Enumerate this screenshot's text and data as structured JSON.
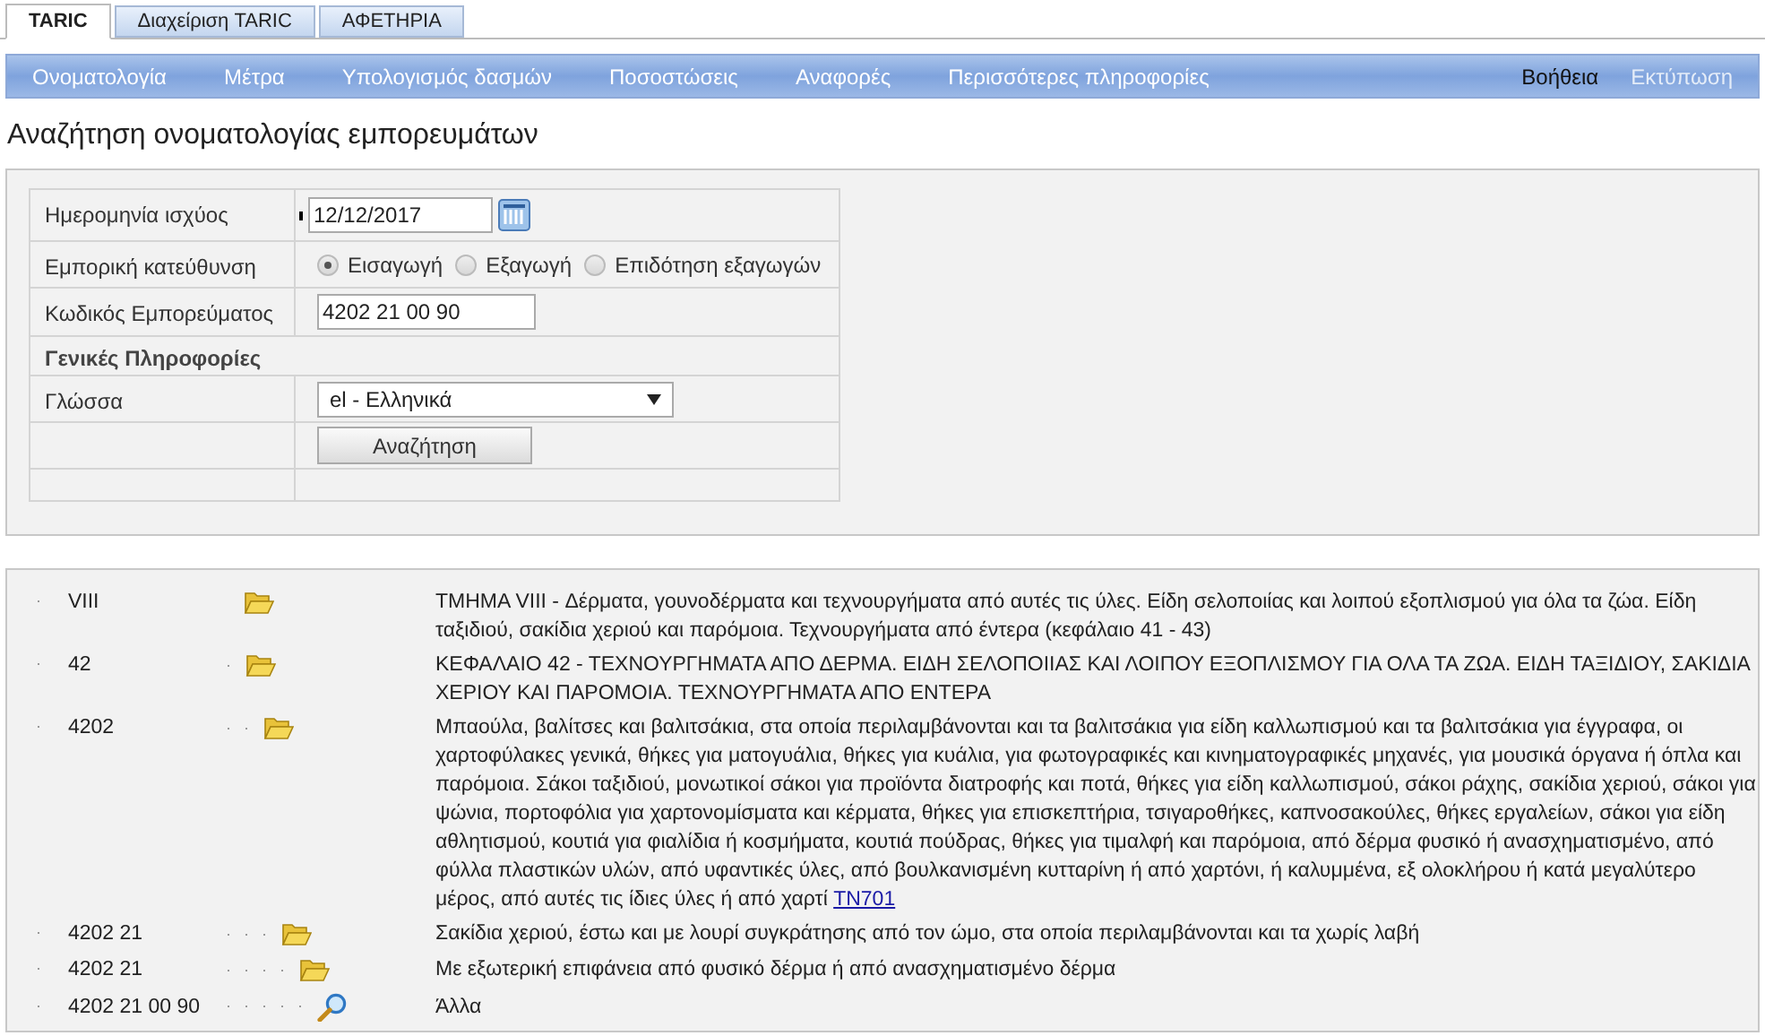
{
  "tabs": [
    {
      "label": "TARIC",
      "selected": true
    },
    {
      "label": "Διαχείριση TARIC",
      "selected": false
    },
    {
      "label": "ΑΦΕΤΗΡΙΑ",
      "selected": false
    }
  ],
  "menu": {
    "items": [
      {
        "label": "Ονοματολογία"
      },
      {
        "label": "Μέτρα"
      },
      {
        "label": "Υπολογισμός δασμών"
      },
      {
        "label": "Ποσοστώσεις"
      },
      {
        "label": "Αναφορές"
      },
      {
        "label": "Περισσότερες πληροφορίες"
      }
    ],
    "right_items": [
      {
        "label": "Βοήθεια",
        "disabled": false
      },
      {
        "label": "Εκτύπωση",
        "disabled": true
      }
    ]
  },
  "page_title": "Αναζήτηση ονοματολογίας εμπορευμάτων",
  "form": {
    "date": {
      "label": "Ημερομηνία ισχύος",
      "value": "12/12/2017"
    },
    "direction": {
      "label": "Εμπορική κατεύθυνση",
      "options": [
        {
          "label": "Εισαγωγή",
          "selected": true
        },
        {
          "label": "Εξαγωγή",
          "selected": false
        },
        {
          "label": "Επιδότηση εξαγωγών",
          "selected": false
        }
      ]
    },
    "code": {
      "label": "Κωδικός Εμπορεύματος",
      "value": "4202 21 00 90"
    },
    "general_info": {
      "label": "Γενικές Πληροφορίες"
    },
    "language": {
      "label": "Γλώσσα",
      "value": "el - Ελληνικά"
    },
    "search_button": "Αναζήτηση"
  },
  "results": [
    {
      "code": "VIII",
      "kind": "folder",
      "description": "ΤΜΗΜΑ VIII - Δέρματα, γουνοδέρματα και τεχνουργήματα από αυτές τις ύλες. Είδη σελοποιίας και λοιπού εξοπλισμού για όλα τα ζώα. Είδη ταξιδιού, σακίδια χεριού και παρόμοια. Τεχνουργήματα από έντερα (κεφάλαιο 41 - 43)",
      "children": [
        {
          "code": "42",
          "kind": "folder",
          "description": "ΚΕΦΑΛΑΙΟ 42 - ΤΕΧΝΟΥΡΓΗΜΑΤΑ ΑΠΟ ΔΕΡΜΑ. ΕΙΔΗ ΣΕΛΟΠΟΙΙΑΣ ΚΑΙ ΛΟΙΠΟΥ ΕΞΟΠΛΙΣΜΟΥ ΓΙΑ ΟΛΑ ΤΑ ΖΩΑ. ΕΙΔΗ ΤΑΞΙΔΙΟΥ, ΣΑΚΙΔΙΑ ΧΕΡΙΟΥ ΚΑΙ ΠΑΡΟΜΟΙΑ. ΤΕΧΝΟΥΡΓΗΜΑΤΑ ΑΠΟ ΕΝΤΕΡΑ",
          "children": [
            {
              "code": "4202",
              "kind": "folder",
              "description": "Μπαούλα, βαλίτσες και βαλιτσάκια, στα οποία περιλαμβάνονται και τα βαλιτσάκια για είδη καλλωπισμού και τα βαλιτσάκια για έγγραφα, οι χαρτοφύλακες γενικά, θήκες για ματογυάλια, θήκες για κυάλια, για φωτογραφικές και κινηματογραφικές μηχανές, για μουσικά όργανα ή όπλα και παρόμοια. Σάκοι ταξιδιού, μονωτικοί σάκοι για προϊόντα διατροφής και ποτά, θήκες για είδη καλλωπισμού, σάκοι ράχης, σακίδια χεριού, σάκοι για ψώνια, πορτοφόλια για χαρτονομίσματα και κέρματα, θήκες για επισκεπτήρια, τσιγαροθήκες, καπνοσακούλες, θήκες εργαλείων, σάκοι για είδη αθλητισμού, κουτιά για φιαλίδια ή κοσμήματα, κουτιά πούδρας, θήκες για τιμαλφή και παρόμοια, από δέρμα φυσικό ή ανασχηματισμένο, από φύλλα πλαστικών υλών, από υφαντικές ύλες, από βουλκανισμένη κυτταρίνη ή από χαρτόνι, ή καλυμμένα, εξ ολοκλήρου ή κατά μεγαλύτερο μέρος, από αυτές τις ίδιες ύλες ή από χαρτί",
              "link": "TN701",
              "children": [
                {
                  "code": "4202 21",
                  "kind": "folder",
                  "description": "Σακίδια χεριού, έστω και με λουρί συγκράτησης από τον ώμο, στα οποία περιλαμβάνονται και τα χωρίς λαβή",
                  "children": [
                    {
                      "code": "4202 21",
                      "kind": "folder",
                      "description": "Με εξωτερική επιφάνεια από φυσικό δέρμα ή από ανασχηματισμένο δέρμα",
                      "children": [
                        {
                          "code": "4202 21 00 90",
                          "kind": "leaf",
                          "description": "Άλλα"
                        }
                      ]
                    }
                  ]
                }
              ]
            }
          ]
        }
      ]
    }
  ]
}
